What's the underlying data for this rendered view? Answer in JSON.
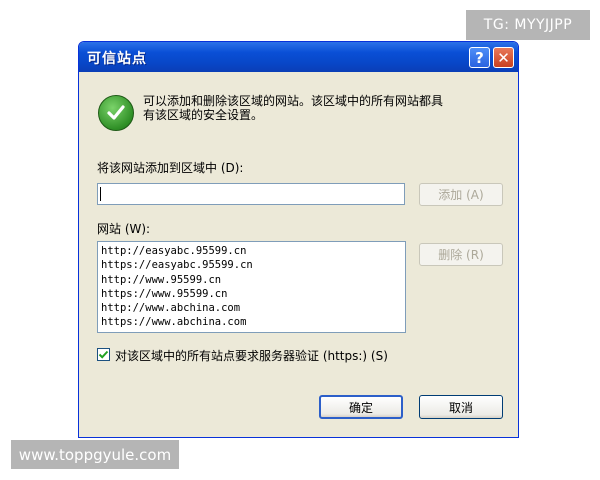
{
  "dialog": {
    "title": "可信站点",
    "help_label": "?",
    "close_label": "✕",
    "info_line1": "可以添加和删除该区域的网站。该区域中的所有网站都具",
    "info_line2": "有该区域的安全设置。",
    "add_label": "将该网站添加到区域中 (D):",
    "add_input_value": "",
    "add_button": "添加 (A)",
    "sites_label": "网站 (W):",
    "sites": [
      "http://easyabc.95599.cn",
      "https://easyabc.95599.cn",
      "http://www.95599.cn",
      "https://www.95599.cn",
      "http://www.abchina.com",
      "https://www.abchina.com"
    ],
    "remove_button": "删除 (R)",
    "require_https_checked": true,
    "require_https_label": "对该区域中的所有站点要求服务器验证 (https:) (S)",
    "ok_button": "确定",
    "cancel_button": "取消"
  },
  "watermarks": {
    "top": "TG: MYYJJPP",
    "bottom": "www.toppgyule.com"
  },
  "icons": {
    "info": "check-icon",
    "checkbox": "checkmark-icon"
  }
}
